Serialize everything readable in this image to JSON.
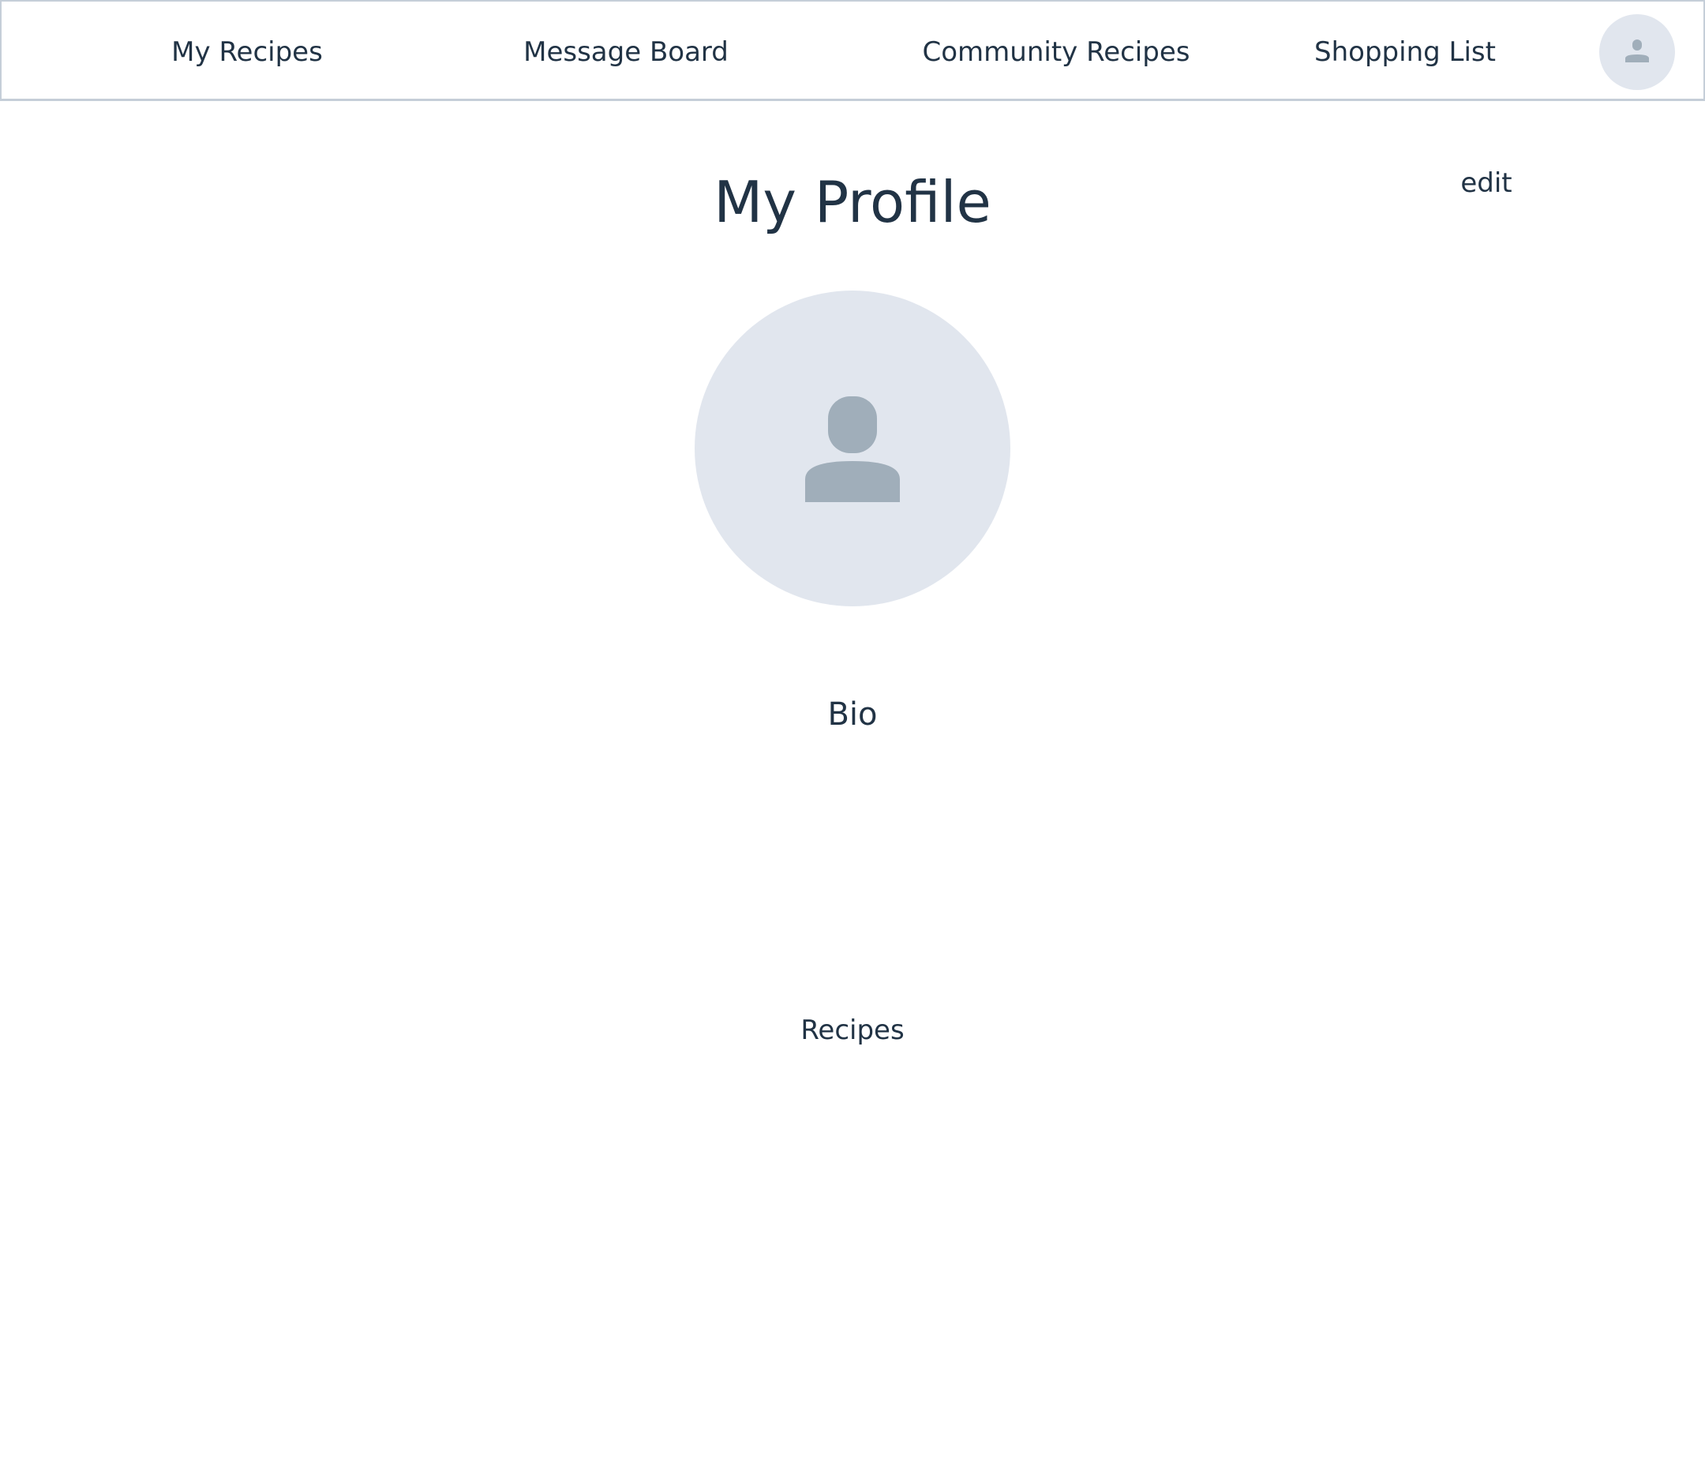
{
  "nav": {
    "items": [
      {
        "label": "My Recipes"
      },
      {
        "label": "Message Board"
      },
      {
        "label": "Community Recipes"
      },
      {
        "label": "Shopping List"
      }
    ],
    "avatar_icon": "user-icon"
  },
  "main": {
    "title": "My Profile",
    "edit_label": "edit",
    "avatar_icon": "user-icon",
    "bio_label": "Bio",
    "recipes_label": "Recipes"
  },
  "colors": {
    "text": "#213345",
    "avatar_bg": "#e1e6ee",
    "icon": "#a0aeba",
    "nav_border": "#c5ced8"
  }
}
